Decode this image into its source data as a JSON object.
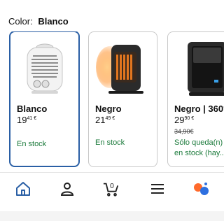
{
  "color_selector": {
    "label": "Color:",
    "value": "Blanco"
  },
  "variants": [
    {
      "name": "Blanco",
      "price_main": "19",
      "price_cents": "41 €",
      "stock": "En stock"
    },
    {
      "name": "Negro",
      "price_main": "21",
      "price_cents": "49 €",
      "stock": "En stock"
    },
    {
      "name": "Negro | 360°",
      "price_main": "29",
      "price_cents": "90 €",
      "old_price": "34,90€",
      "stock_line1": "Sólo queda(n) 1",
      "stock_line2": "en stock (hay..."
    }
  ],
  "nav": {
    "icons": [
      "home-icon",
      "account-icon",
      "cart-icon",
      "menu-icon",
      "assistant-icon"
    ],
    "cart_count": "0",
    "accent": "#2a5fa5"
  }
}
